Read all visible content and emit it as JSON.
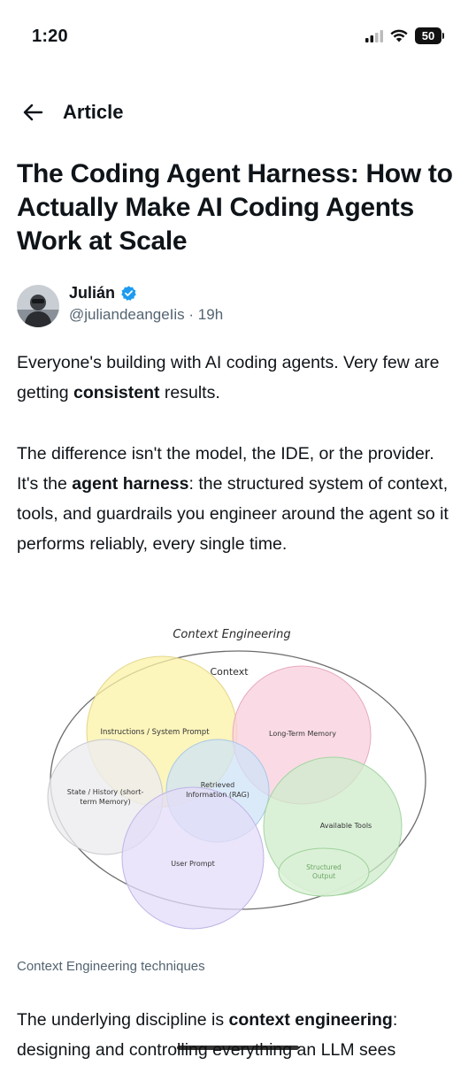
{
  "status_bar": {
    "time": "1:20",
    "battery": "50"
  },
  "nav": {
    "title": "Article"
  },
  "article": {
    "title": "The Coding Agent Harness: How to Actually Make AI Coding Agents Work at Scale",
    "author": {
      "name": "Julián",
      "handle": "@juliandeangeIis",
      "time": "· 19h"
    },
    "p1": {
      "a": "Everyone's building with AI coding agents. Very few are getting ",
      "b": "consistent",
      "c": " results."
    },
    "p2": {
      "a": "The difference isn't the model, the IDE, or the provider. It's the ",
      "b": "agent harness",
      "c": ": the structured system of context, tools, and guardrails you engineer around the agent so it performs reliably, every single time."
    },
    "p3": {
      "a": "The underlying discipline is ",
      "b": "context engineering",
      "c": ":",
      "d": "designing and controlling everything an LLM sees"
    }
  },
  "diagram": {
    "title": "Context Engineering",
    "outer_label": "Context",
    "circles": [
      {
        "label": "Instructions / System Prompt",
        "color": "#fbf1a6"
      },
      {
        "label": "Long-Term Memory",
        "color": "#f8cfdc"
      },
      {
        "label": "State / History (short-term Memory)",
        "color": "#ececef"
      },
      {
        "label": "Retrieved Information (RAG)",
        "color": "#cfe3f7"
      },
      {
        "label": "Available Tools",
        "color": "#cdeccb"
      },
      {
        "label": "User Prompt",
        "color": "#e3dcf8"
      },
      {
        "label": "Structured Output",
        "color": "#dbf1d7"
      }
    ],
    "caption": "Context Engineering techniques"
  }
}
